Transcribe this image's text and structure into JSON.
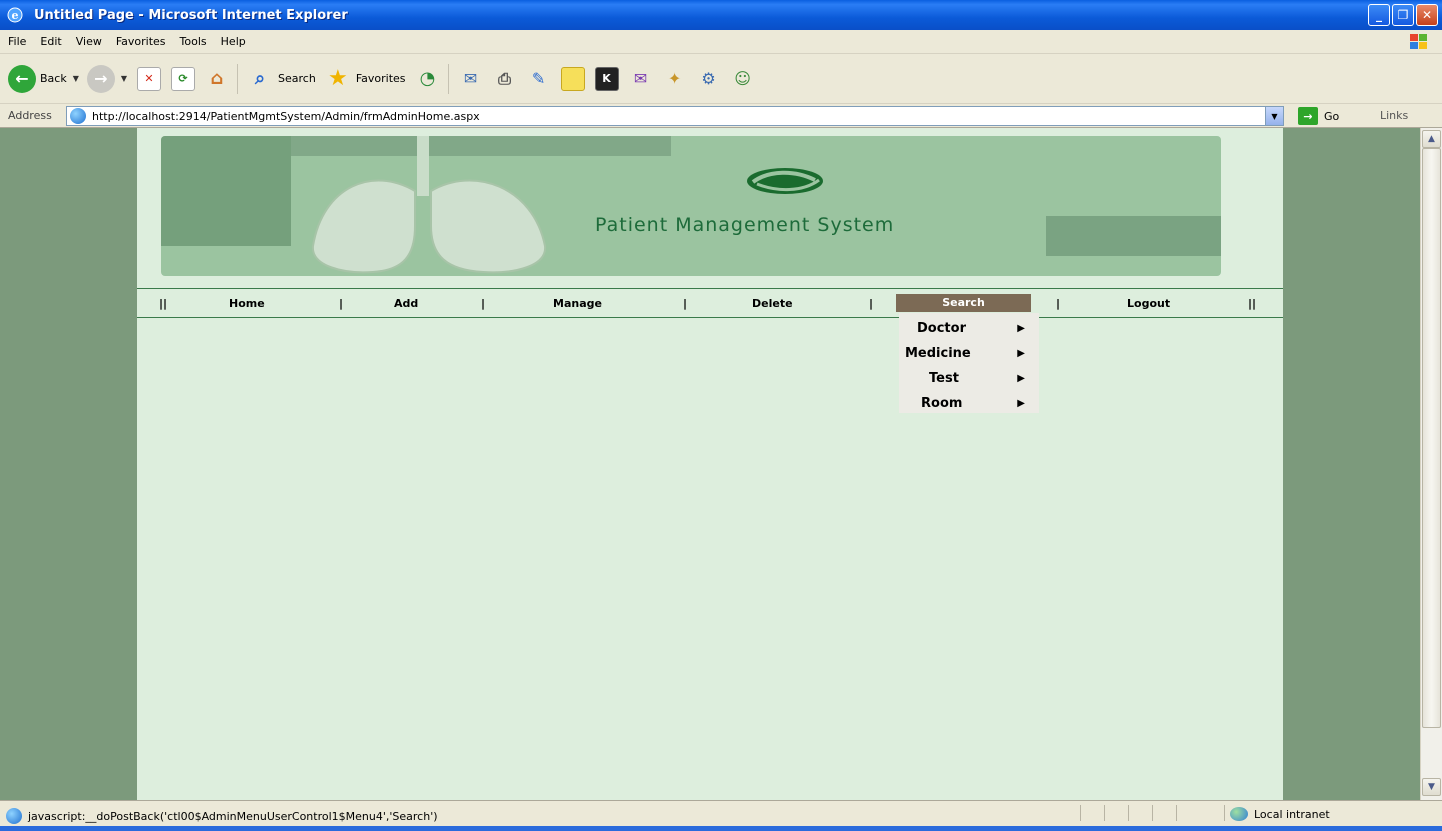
{
  "window": {
    "title": "Untitled Page - Microsoft Internet Explorer",
    "minimize": "_",
    "maximize": "❐",
    "close": "✕"
  },
  "menubar": {
    "items": [
      "File",
      "Edit",
      "View",
      "Favorites",
      "Tools",
      "Help"
    ]
  },
  "toolbar": {
    "back": "Back",
    "search": "Search",
    "favorites": "Favorites"
  },
  "address": {
    "label": "Address",
    "url": "http://localhost:2914/PatientMgmtSystem/Admin/frmAdminHome.aspx",
    "go": "Go",
    "links": "Links"
  },
  "page": {
    "system_title": "Patient Management System",
    "nav": {
      "items": [
        "Home",
        "Add",
        "Manage",
        "Delete",
        "Search",
        "Logout"
      ],
      "separator": "|",
      "edge": "||",
      "active": "Search"
    },
    "search_menu": {
      "items": [
        "Doctor",
        "Medicine",
        "Test",
        "Room"
      ],
      "arrow": "▶"
    }
  },
  "status": {
    "text": "javascript:__doPostBack('ctl00$AdminMenuUserControl1$Menu4','Search')",
    "zone": "Local intranet"
  },
  "icons": {
    "ie": "ie-icon",
    "back": "back-arrow-icon",
    "forward": "forward-arrow-icon",
    "stop": "stop-icon",
    "refresh": "refresh-icon",
    "home": "home-icon",
    "search": "search-icon",
    "favorites": "favorites-star-icon",
    "history": "history-icon",
    "mail": "mail-icon",
    "print": "print-icon"
  }
}
